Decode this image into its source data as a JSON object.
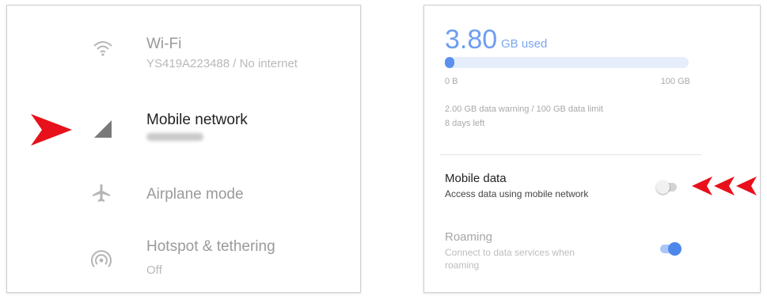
{
  "settings_list": {
    "items": [
      {
        "id": "wifi",
        "title": "Wi-Fi",
        "subtitle": "YS419A223488 / No internet",
        "icon": "wifi-icon"
      },
      {
        "id": "mobile-network",
        "title": "Mobile network",
        "subtitle": "",
        "icon": "signal-icon",
        "highlighted": true
      },
      {
        "id": "airplane",
        "title": "Airplane mode",
        "subtitle": "",
        "icon": "airplane-icon"
      },
      {
        "id": "hotspot",
        "title": "Hotspot & tethering",
        "subtitle": "Off",
        "icon": "hotspot-icon"
      }
    ]
  },
  "data_usage": {
    "amount": "3.80",
    "unit_label": "GB used",
    "fraction_used": 0.038,
    "range_min_label": "0 B",
    "range_max_label": "100 GB",
    "warning_text": "2.00 GB data warning / 100 GB data limit",
    "days_left": "8 days left"
  },
  "mobile_data": {
    "title": "Mobile data",
    "subtitle": "Access data using mobile network",
    "enabled": false
  },
  "roaming": {
    "title": "Roaming",
    "subtitle_line1": "Connect to data services when",
    "subtitle_line2": "roaming",
    "enabled": true
  },
  "colors": {
    "accent": "#5b91ee",
    "annotation_arrow": "#e8101a"
  }
}
